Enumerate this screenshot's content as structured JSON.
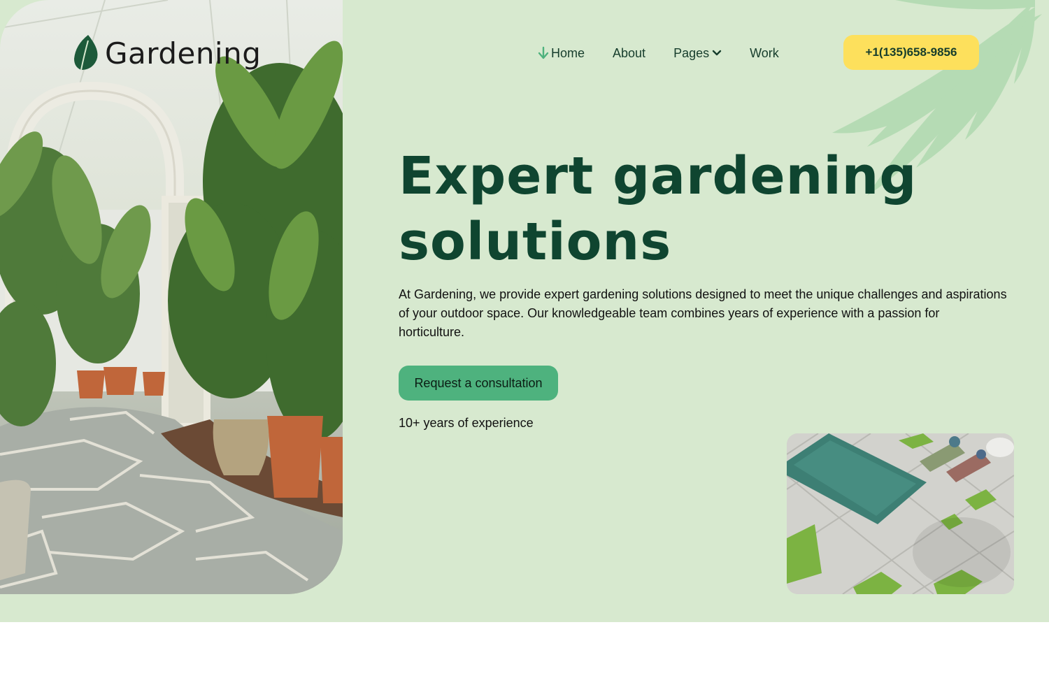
{
  "brand": {
    "name": "Gardening"
  },
  "nav": {
    "items": [
      {
        "label": "Home",
        "active": true
      },
      {
        "label": "About"
      },
      {
        "label": "Pages",
        "has_dropdown": true
      },
      {
        "label": "Work"
      }
    ]
  },
  "contact": {
    "phone": "+1(135)658-9856"
  },
  "hero": {
    "headline_line1": "Expert gardening",
    "headline_line2": "solutions",
    "description": "At Gardening, we provide expert gardening solutions designed to meet the unique challenges and aspirations of your outdoor space. Our knowledgeable team combines years of experience with a passion for horticulture.",
    "cta_label": "Request a consultation",
    "experience": "10+ years of experience"
  },
  "colors": {
    "background": "#d7e9cf",
    "heading": "#0f4530",
    "accent_green": "#4eb27e",
    "accent_yellow": "#fde05c"
  },
  "icons": {
    "logo": "leaf-icon",
    "active_nav": "arrow-down-icon",
    "dropdown": "chevron-down-icon"
  }
}
